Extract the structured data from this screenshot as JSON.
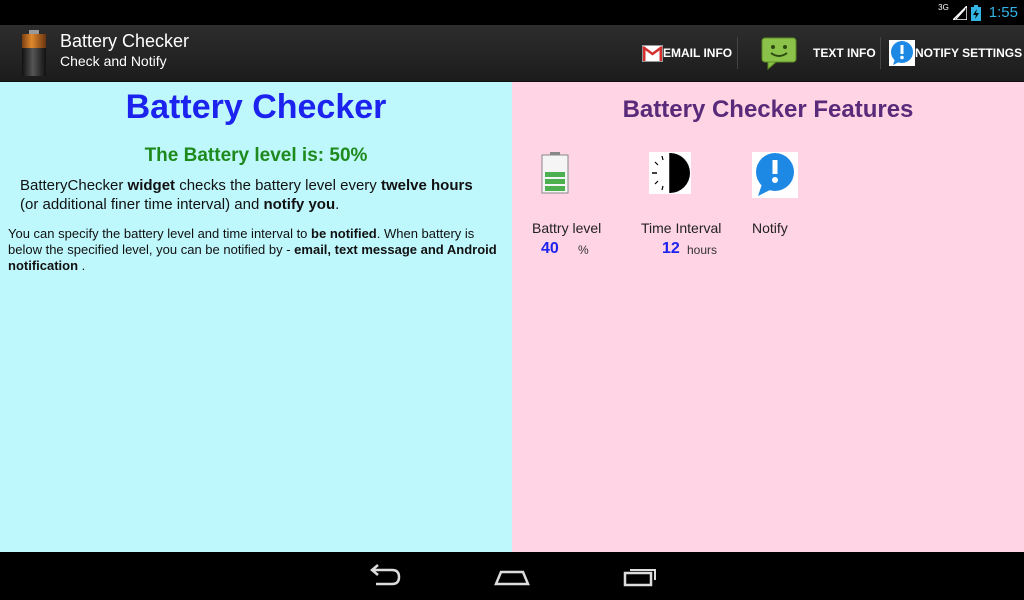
{
  "status": {
    "network": "3G",
    "time": "1:55"
  },
  "actionbar": {
    "title": "Battery Checker",
    "subtitle": "Check and Notify",
    "email_label": "EMAIL INFO",
    "text_label": "TEXT INFO",
    "notify_label": "NOTIFY SETTINGS"
  },
  "left": {
    "heading": "Battery Checker",
    "level_text": "The Battery level is: 50%",
    "para1": {
      "a": "BatteryChecker ",
      "b": "widget",
      "c": " checks the battery level every  ",
      "d": "twelve hours",
      "e": "(or additional finer time interval) and ",
      "f": "notify you",
      "g": "."
    },
    "para2": {
      "a": " You can specify the battery level and time interval to ",
      "b": "be notified",
      "c": ". When battery is below the specified level, you can be notified by - ",
      "d": "email, text message and Android notification",
      "e": " ."
    }
  },
  "right": {
    "heading": "Battery Checker Features",
    "features": [
      {
        "label": "Battry level",
        "value": "40",
        "unit": "%",
        "icon": "battery-icon"
      },
      {
        "label": "Time Interval",
        "value": "12",
        "unit": "hours",
        "icon": "clock-icon"
      },
      {
        "label": "Notify",
        "value": "",
        "unit": "",
        "icon": "notify-icon"
      }
    ]
  },
  "colors": {
    "left_bg": "#bff8fc",
    "right_bg": "#ffd4e4",
    "heading_blue": "#1d23ee",
    "level_green": "#1e8a1e",
    "features_purple": "#5a2a7a",
    "clock_blue": "#33b5e5"
  }
}
